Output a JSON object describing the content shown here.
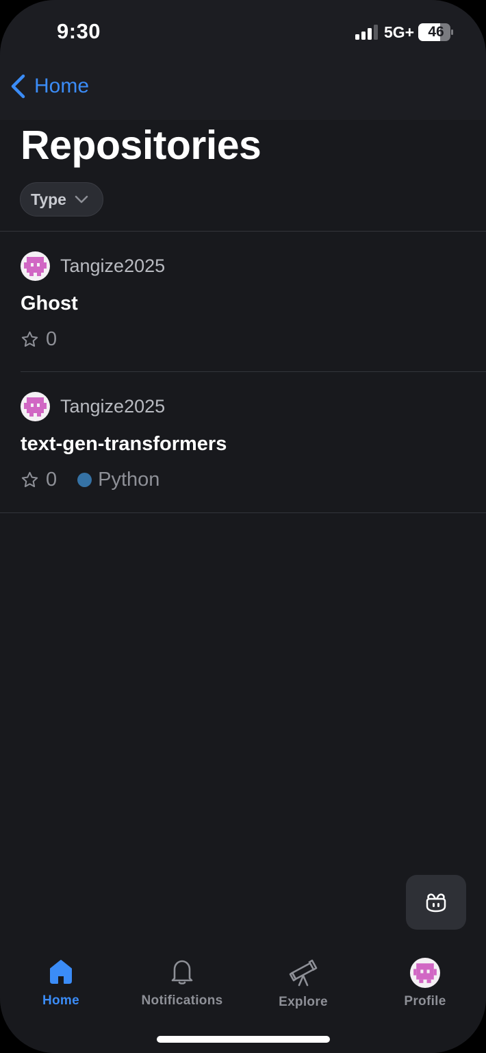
{
  "status_bar": {
    "time": "9:30",
    "network": "5G+",
    "battery": "46"
  },
  "nav": {
    "back_label": "Home"
  },
  "page": {
    "title": "Repositories",
    "filter_label": "Type"
  },
  "repositories": [
    {
      "owner": "Tangize2025",
      "name": "Ghost",
      "stars": "0",
      "language": ""
    },
    {
      "owner": "Tangize2025",
      "name": "text-gen-transformers",
      "stars": "0",
      "language": "Python",
      "language_color": "#3572a5"
    }
  ],
  "tab_bar": {
    "tabs": [
      {
        "label": "Home",
        "icon": "home-icon",
        "active": true
      },
      {
        "label": "Notifications",
        "icon": "bell-icon",
        "active": false
      },
      {
        "label": "Explore",
        "icon": "telescope-icon",
        "active": false
      },
      {
        "label": "Profile",
        "icon": "avatar",
        "active": false
      }
    ]
  },
  "colors": {
    "accent": "#3b8cf7",
    "background": "#18191d",
    "avatar_pink": "#d167c4"
  }
}
